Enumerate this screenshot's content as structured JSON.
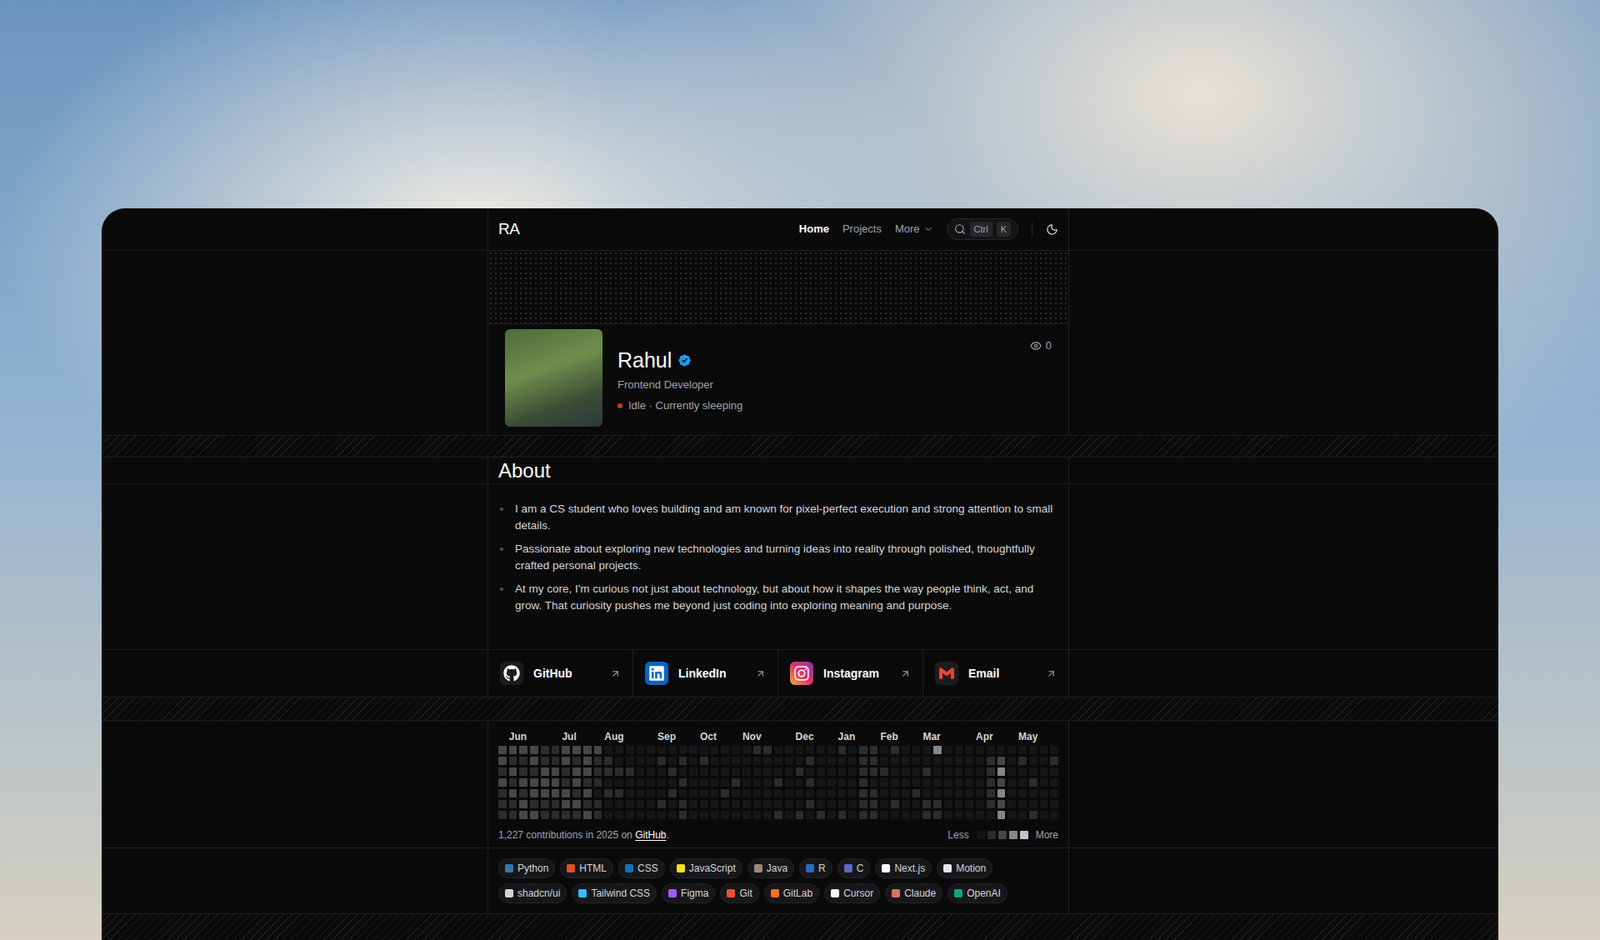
{
  "nav": {
    "logo": "RA",
    "links": [
      {
        "label": "Home",
        "selected": true
      },
      {
        "label": "Projects",
        "selected": false
      }
    ],
    "more": "More",
    "search_keys": [
      "Ctrl",
      "K"
    ]
  },
  "profile": {
    "name": "Rahul",
    "verified": true,
    "role": "Frontend Developer",
    "status": "Idle · Currently sleeping",
    "state": "idle",
    "views": "0"
  },
  "about": {
    "title": "About",
    "bullets": [
      "I am a CS student who loves building and am known for pixel-perfect execution and strong attention to small details.",
      "Passionate about exploring new technologies and turning ideas into reality through polished, thoughtfully crafted personal projects.",
      "At my core, I'm curious not just about technology, but about how it shapes the way people think, act, and grow. That curiosity pushes me beyond just coding into exploring meaning and purpose."
    ]
  },
  "socials": [
    {
      "label": "GitHub",
      "kind": "github"
    },
    {
      "label": "LinkedIn",
      "kind": "linkedin"
    },
    {
      "label": "Instagram",
      "kind": "instagram"
    },
    {
      "label": "Email",
      "kind": "email"
    }
  ],
  "contributions": {
    "months": [
      {
        "label": "Jun",
        "week": 1
      },
      {
        "label": "Jul",
        "week": 6
      },
      {
        "label": "Aug",
        "week": 10
      },
      {
        "label": "Sep",
        "week": 15
      },
      {
        "label": "Oct",
        "week": 19
      },
      {
        "label": "Nov",
        "week": 23
      },
      {
        "label": "Dec",
        "week": 28
      },
      {
        "label": "Jan",
        "week": 32
      },
      {
        "label": "Feb",
        "week": 36
      },
      {
        "label": "Mar",
        "week": 40
      },
      {
        "label": "Apr",
        "week": 45
      },
      {
        "label": "May",
        "week": 49
      }
    ],
    "weeks": [
      [
        2,
        2,
        1,
        2,
        1,
        1,
        1
      ],
      [
        2,
        1,
        2,
        1,
        2,
        1,
        1
      ],
      [
        2,
        1,
        1,
        2,
        1,
        2,
        2
      ],
      [
        2,
        2,
        1,
        2,
        2,
        1,
        2
      ],
      [
        1,
        1,
        2,
        2,
        2,
        1,
        1
      ],
      [
        1,
        1,
        2,
        2,
        2,
        1,
        1
      ],
      [
        2,
        2,
        1,
        1,
        2,
        2,
        1
      ],
      [
        2,
        1,
        2,
        2,
        1,
        2,
        1
      ],
      [
        2,
        2,
        2,
        1,
        2,
        1,
        2
      ],
      [
        2,
        1,
        1,
        1,
        0,
        1,
        1
      ],
      [
        0,
        1,
        1,
        0,
        1,
        0,
        0
      ],
      [
        0,
        0,
        1,
        0,
        1,
        0,
        0
      ],
      [
        0,
        0,
        1,
        0,
        0,
        0,
        0
      ],
      [
        0,
        0,
        0,
        0,
        0,
        0,
        0
      ],
      [
        0,
        0,
        0,
        0,
        0,
        0,
        0
      ],
      [
        0,
        1,
        0,
        0,
        0,
        1,
        0
      ],
      [
        0,
        0,
        1,
        0,
        1,
        0,
        0
      ],
      [
        0,
        1,
        0,
        1,
        0,
        1,
        1
      ],
      [
        0,
        0,
        0,
        0,
        0,
        0,
        0
      ],
      [
        0,
        1,
        0,
        0,
        0,
        0,
        0
      ],
      [
        0,
        0,
        0,
        0,
        0,
        0,
        0
      ],
      [
        0,
        0,
        0,
        0,
        1,
        0,
        0
      ],
      [
        0,
        0,
        0,
        1,
        0,
        0,
        0
      ],
      [
        0,
        0,
        0,
        0,
        0,
        0,
        0
      ],
      [
        1,
        0,
        0,
        0,
        0,
        0,
        0
      ],
      [
        1,
        0,
        0,
        0,
        0,
        0,
        0
      ],
      [
        0,
        0,
        0,
        1,
        0,
        0,
        1
      ],
      [
        0,
        0,
        0,
        0,
        0,
        0,
        0
      ],
      [
        0,
        0,
        1,
        0,
        0,
        0,
        1
      ],
      [
        0,
        1,
        0,
        1,
        0,
        1,
        0
      ],
      [
        0,
        0,
        0,
        0,
        0,
        0,
        1
      ],
      [
        0,
        0,
        0,
        0,
        0,
        0,
        0
      ],
      [
        1,
        0,
        0,
        0,
        0,
        0,
        1
      ],
      [
        0,
        0,
        0,
        0,
        0,
        0,
        0
      ],
      [
        1,
        1,
        1,
        1,
        1,
        1,
        1
      ],
      [
        1,
        1,
        1,
        0,
        1,
        1,
        1
      ],
      [
        0,
        0,
        1,
        0,
        0,
        0,
        0
      ],
      [
        1,
        0,
        0,
        0,
        0,
        1,
        0
      ],
      [
        0,
        0,
        0,
        0,
        0,
        0,
        0
      ],
      [
        0,
        0,
        0,
        0,
        1,
        0,
        0
      ],
      [
        0,
        0,
        1,
        0,
        0,
        1,
        1
      ],
      [
        3,
        0,
        0,
        0,
        0,
        1,
        1
      ],
      [
        0,
        0,
        0,
        0,
        0,
        0,
        0
      ],
      [
        0,
        0,
        0,
        0,
        0,
        0,
        0
      ],
      [
        0,
        0,
        0,
        0,
        0,
        0,
        0
      ],
      [
        0,
        0,
        0,
        0,
        0,
        0,
        0
      ],
      [
        0,
        1,
        1,
        1,
        1,
        1,
        0
      ],
      [
        0,
        2,
        3,
        2,
        3,
        2,
        3
      ],
      [
        0,
        0,
        0,
        0,
        0,
        0,
        0
      ],
      [
        0,
        1,
        0,
        0,
        0,
        0,
        0
      ],
      [
        0,
        0,
        0,
        1,
        0,
        0,
        1
      ],
      [
        0,
        0,
        0,
        0,
        0,
        0,
        0
      ],
      [
        0,
        1,
        0,
        0,
        0,
        0,
        0
      ]
    ],
    "summary_prefix": "1,227 contributions in 2025 on ",
    "summary_link": "GitHub",
    "summary_suffix": ".",
    "legend_less": "Less",
    "legend_more": "More",
    "legend_levels": [
      0,
      1,
      2,
      3,
      4
    ]
  },
  "tech": [
    {
      "label": "Python",
      "color": "#3776ab"
    },
    {
      "label": "HTML",
      "color": "#e34f26"
    },
    {
      "label": "CSS",
      "color": "#1572b6"
    },
    {
      "label": "JavaScript",
      "color": "#f7df1e"
    },
    {
      "label": "Java",
      "color": "#9a8a7a"
    },
    {
      "label": "R",
      "color": "#276dc3"
    },
    {
      "label": "C",
      "color": "#5c6bc0"
    },
    {
      "label": "Next.js",
      "color": "#ffffff"
    },
    {
      "label": "Motion",
      "color": "#e5e5e5"
    },
    {
      "label": "shadcn/ui",
      "color": "#d4d4d4"
    },
    {
      "label": "Tailwind CSS",
      "color": "#38bdf8"
    },
    {
      "label": "Figma",
      "color": "#a259ff"
    },
    {
      "label": "Git",
      "color": "#f05032"
    },
    {
      "label": "GitLab",
      "color": "#fc6d26"
    },
    {
      "label": "Cursor",
      "color": "#f5f5f5"
    },
    {
      "label": "Claude",
      "color": "#d97757"
    },
    {
      "label": "OpenAI",
      "color": "#10a37f"
    }
  ]
}
